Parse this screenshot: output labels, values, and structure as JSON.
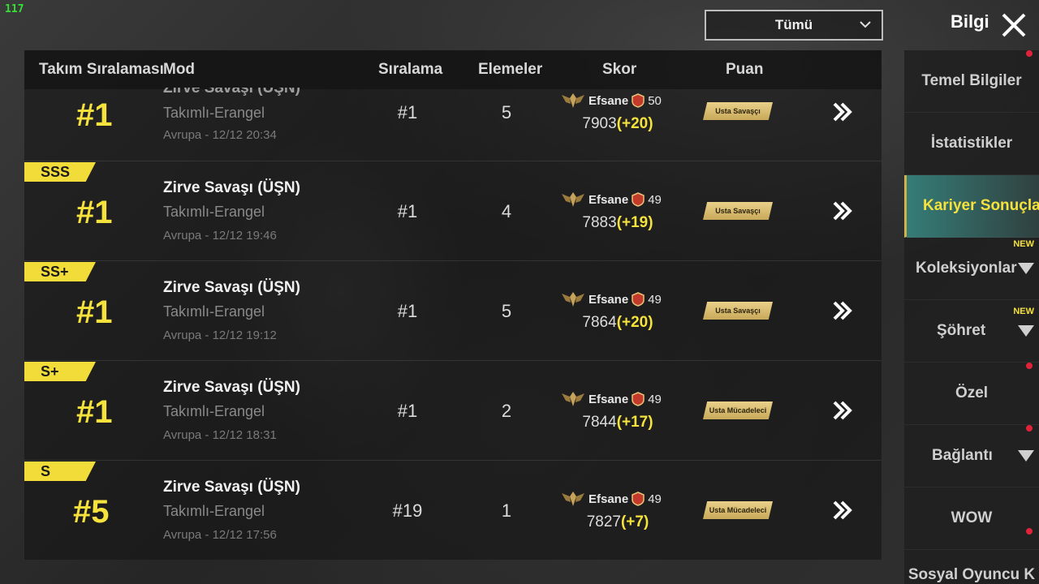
{
  "fps": "117",
  "filter": {
    "value": "Tümü"
  },
  "header": {
    "title": "Bilgi"
  },
  "columns": {
    "team_rank": "Takım Sıralaması",
    "mode": "Mod",
    "placement": "Sıralama",
    "kills": "Elemeler",
    "score": "Skor",
    "rating": "Puan"
  },
  "rows": [
    {
      "grade": "",
      "rank": "#1",
      "mode": "Zirve Savaşı (ÜŞN)",
      "map": "Takımlı-Erangel",
      "date": "Avrupa - 12/12 20:34",
      "placement": "#1",
      "kills": "5",
      "tier": "Efsane",
      "level": "50",
      "score": "7903",
      "delta": "(+20)",
      "badge": "Usta Savaşçı"
    },
    {
      "grade": "SSS",
      "rank": "#1",
      "mode": "Zirve Savaşı (ÜŞN)",
      "map": "Takımlı-Erangel",
      "date": "Avrupa - 12/12 19:46",
      "placement": "#1",
      "kills": "4",
      "tier": "Efsane",
      "level": "49",
      "score": "7883",
      "delta": "(+19)",
      "badge": "Usta Savaşçı"
    },
    {
      "grade": "SS+",
      "rank": "#1",
      "mode": "Zirve Savaşı (ÜŞN)",
      "map": "Takımlı-Erangel",
      "date": "Avrupa - 12/12 19:12",
      "placement": "#1",
      "kills": "5",
      "tier": "Efsane",
      "level": "49",
      "score": "7864",
      "delta": "(+20)",
      "badge": "Usta Savaşçı"
    },
    {
      "grade": "S+",
      "rank": "#1",
      "mode": "Zirve Savaşı (ÜŞN)",
      "map": "Takımlı-Erangel",
      "date": "Avrupa - 12/12 18:31",
      "placement": "#1",
      "kills": "2",
      "tier": "Efsane",
      "level": "49",
      "score": "7844",
      "delta": "(+17)",
      "badge": "Usta Mücadeleci"
    },
    {
      "grade": "S",
      "rank": "#5",
      "mode": "Zirve Savaşı (ÜŞN)",
      "map": "Takımlı-Erangel",
      "date": "Avrupa - 12/12 17:56",
      "placement": "#19",
      "kills": "1",
      "tier": "Efsane",
      "level": "49",
      "score": "7827",
      "delta": "(+7)",
      "badge": "Usta Mücadeleci"
    }
  ],
  "sidebar": {
    "new_label": "NEW",
    "items": [
      {
        "label": "Temel Bilgiler"
      },
      {
        "label": "İstatistikler"
      },
      {
        "label": "Kariyer Sonuçla"
      },
      {
        "label": "Koleksiyonlar"
      },
      {
        "label": "Şöhret"
      },
      {
        "label": "Özel"
      },
      {
        "label": "Bağlantı"
      },
      {
        "label": "WOW"
      },
      {
        "label": "Sosyal Oyuncu K"
      }
    ]
  },
  "colors": {
    "accent_yellow": "#f5e23c",
    "active_tab": "#46c8be",
    "notify_dot": "#e0233a"
  }
}
